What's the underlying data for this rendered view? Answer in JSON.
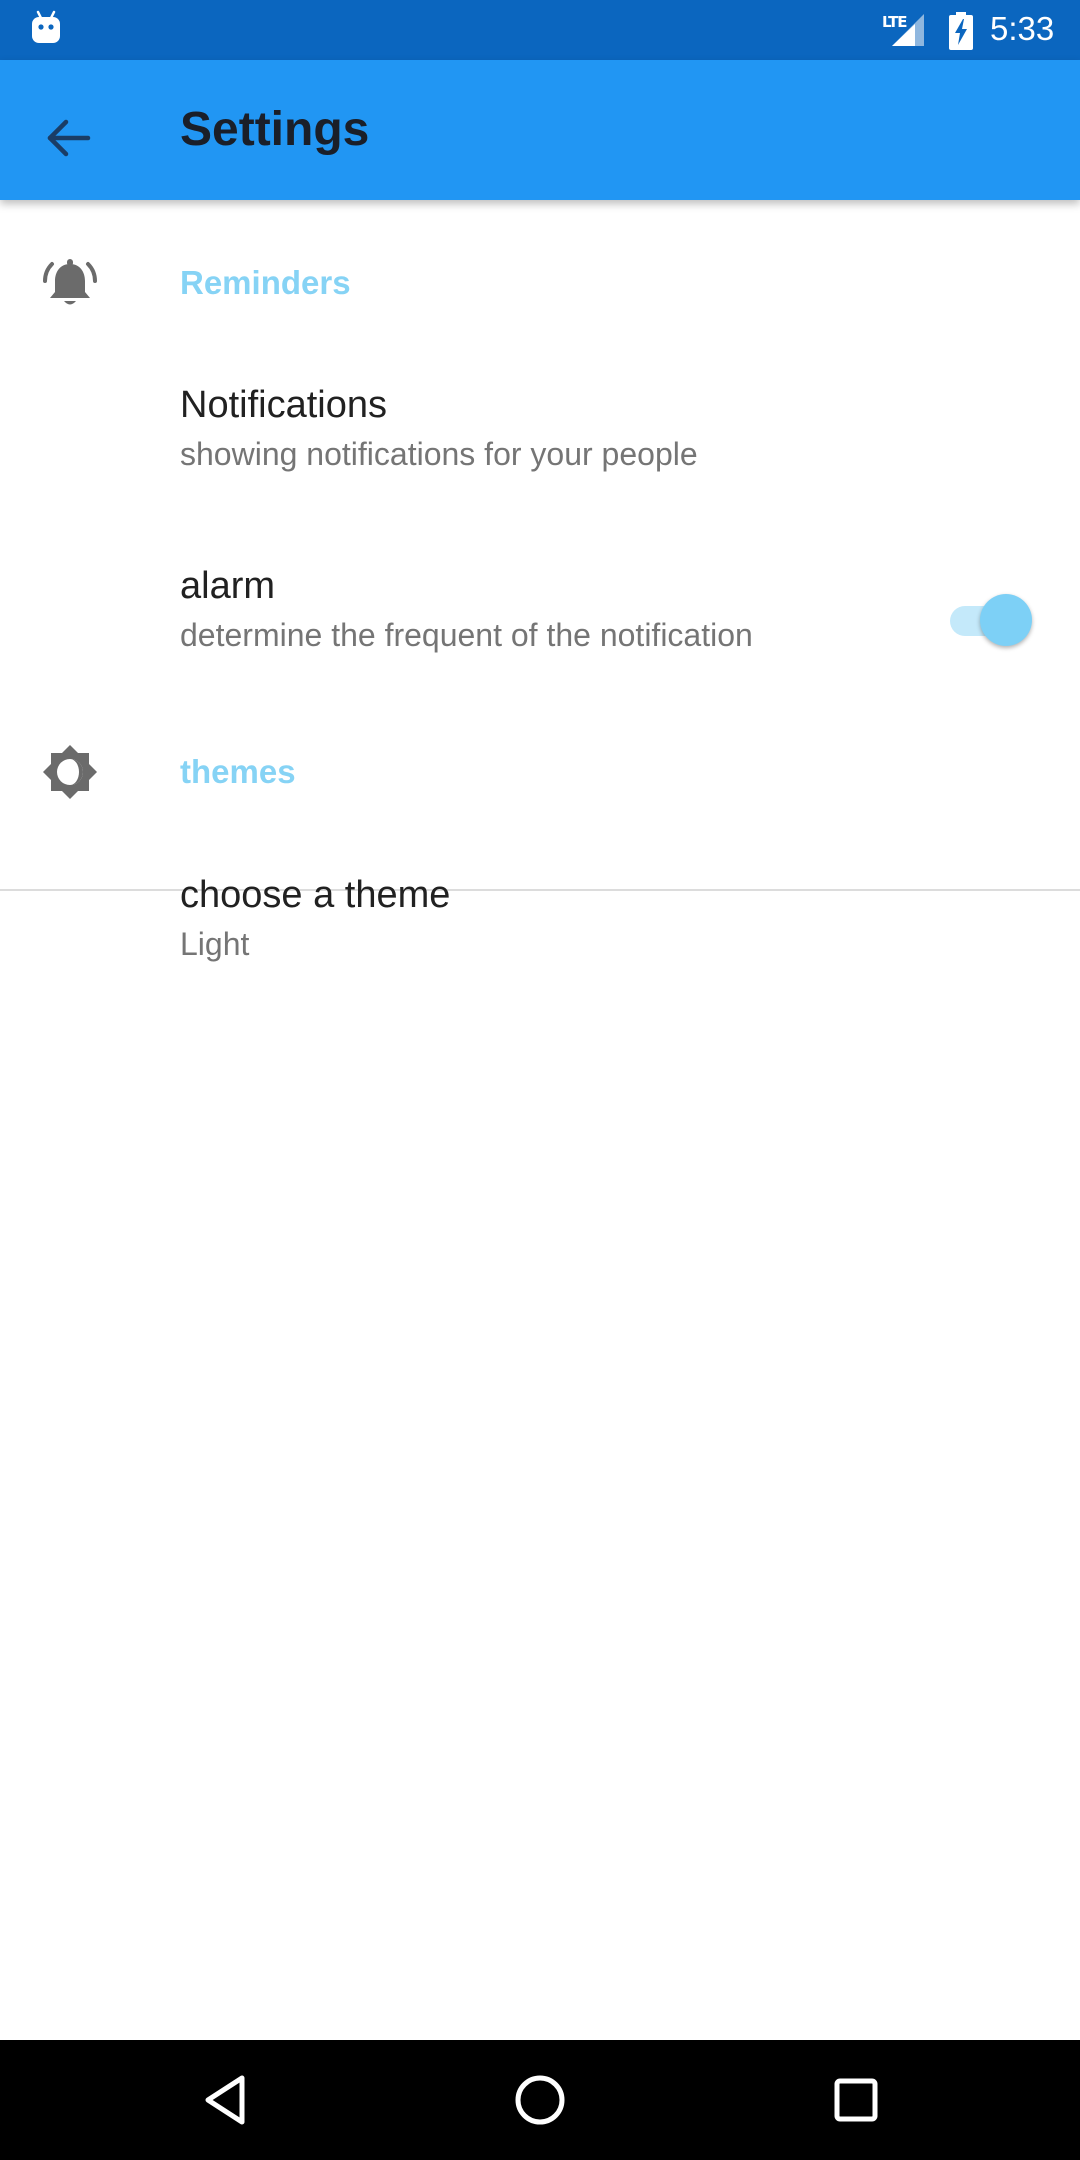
{
  "status_bar": {
    "time": "5:33",
    "network": "LTE",
    "icons": [
      "android-icon",
      "signal-icon",
      "battery-charging-icon"
    ]
  },
  "app_bar": {
    "title": "Settings",
    "back_icon": "arrow-back-icon"
  },
  "sections": [
    {
      "title": "Reminders",
      "icon": "bell-ringing-icon",
      "items": [
        {
          "title": "Notifications",
          "summary": "showing notifications for your people",
          "switch_on": true
        },
        {
          "title": "alarm",
          "summary": "determine the frequent of the notification"
        }
      ]
    },
    {
      "title": "themes",
      "icon": "brightness-icon",
      "items": [
        {
          "title": "choose a theme",
          "summary": "Light"
        }
      ]
    }
  ],
  "nav_bar": {
    "buttons": [
      "back-triangle-icon",
      "home-circle-icon",
      "recents-square-icon"
    ]
  },
  "colors": {
    "status_bar": "#0b66bf",
    "app_bar": "#2196f3",
    "category_title": "#86d3f5",
    "switch_thumb": "#7dd0f6",
    "switch_track": "#c4e9fa"
  }
}
